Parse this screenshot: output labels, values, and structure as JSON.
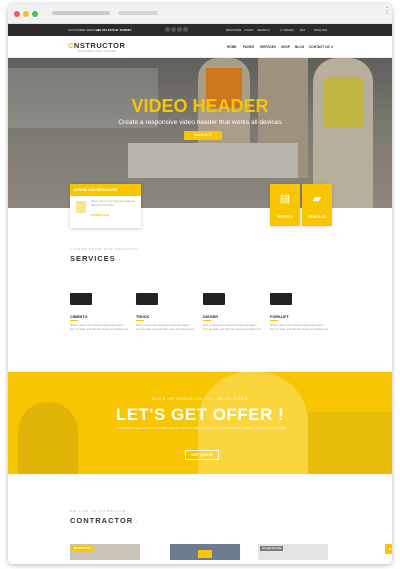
{
  "topbar": {
    "customer_service_label": "CUSTOMER SERVICE:",
    "phone": "+90 044 9779 31 TURKEY",
    "links": [
      "REGISTER",
      "LOGIN",
      "SEARCH"
    ],
    "items": "1 ITEM(S)",
    "price": "$00",
    "language": "ENGLISH"
  },
  "nav": {
    "logo_prefix": "C",
    "logo_rest": "NSTRUCTOR",
    "logo_tagline": "BUILDING A NEW FUTURE",
    "items": [
      "HOME",
      "PAGES",
      "SERVICES",
      "SHOP",
      "BLOG",
      "CONTACT US"
    ]
  },
  "hero": {
    "title": "VIDEO HEADER",
    "subtitle": "Create a responsive video header that works all devices",
    "button": "WATCH IT"
  },
  "download": {
    "header": "DOWNLOAD BROCHURE",
    "text": "Where I came to be closed the books and papers from the table",
    "link": "DOWNLOAD"
  },
  "tiles": [
    {
      "label": "SERVICE",
      "icon": "document-icon"
    },
    {
      "label": "VEHICLES",
      "icon": "truck-icon"
    }
  ],
  "services": {
    "kicker": "THINGS FROM OUR OFFERING",
    "title": "SERVICES",
    "items": [
      {
        "name": "CIMENTO",
        "icon": "cement-mixer-icon",
        "text": "When I came to be closed the books and papers from the table, and with that I know were please and"
      },
      {
        "name": "TRUCK",
        "icon": "dump-truck-icon",
        "text": "When I came to be closed the books and papers from the table, and with that I know were please and"
      },
      {
        "name": "DIGGER",
        "icon": "excavator-icon",
        "text": "When I came to be closed the books and papers from the table, and with that I know were please and"
      },
      {
        "name": "FORKLIFT",
        "icon": "forklift-icon",
        "text": "When I came to be closed the books and papers from the table, and with that I know were please and"
      }
    ]
  },
  "offer": {
    "kicker": "MORE INFORMATION FILL UP TO FORM",
    "title": "LET'S GET OFFER !",
    "text": "Full flexibility to add and edit a theme with a single and rich theme. Select a group of contractors providing services that you require for your project.",
    "button": "GET QUOTE"
  },
  "contractor": {
    "kicker": "WE LIKE TO INTRODUCE",
    "title": "CONTRACTOR",
    "cards": [
      "MAIN OFFICE",
      "",
      "Google Chrome"
    ]
  },
  "colors": {
    "accent": "#f7c600",
    "dark_bar": "#2b2b2b"
  }
}
